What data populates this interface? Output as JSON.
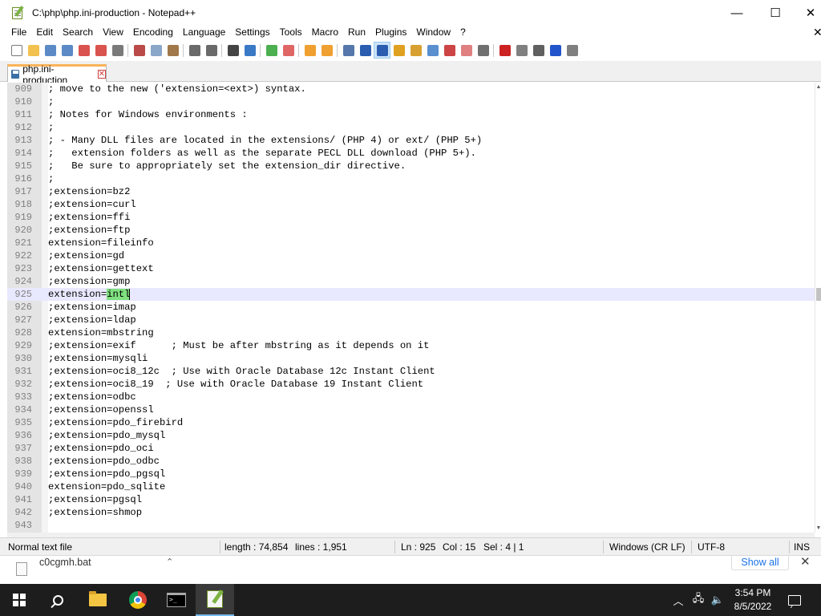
{
  "window": {
    "title": "C:\\php\\php.ini-production - Notepad++",
    "minimize": "—",
    "maximize": "☐",
    "close": "✕"
  },
  "menu": [
    "File",
    "Edit",
    "Search",
    "View",
    "Encoding",
    "Language",
    "Settings",
    "Tools",
    "Macro",
    "Run",
    "Plugins",
    "Window",
    "?"
  ],
  "menu_close": "✕",
  "toolbar_icons": [
    {
      "name": "new-file-icon",
      "color": "#ffffff",
      "border": "#7a7a7a"
    },
    {
      "name": "open-file-icon",
      "color": "#f2c14e"
    },
    {
      "name": "save-icon",
      "color": "#5b8ac7"
    },
    {
      "name": "save-all-icon",
      "color": "#5b8ac7"
    },
    {
      "name": "close-file-icon",
      "color": "#d9534f"
    },
    {
      "name": "close-all-icon",
      "color": "#d9534f"
    },
    {
      "name": "print-icon",
      "color": "#7a7a7a"
    },
    {
      "sep": true
    },
    {
      "name": "cut-icon",
      "color": "#b94a48"
    },
    {
      "name": "copy-icon",
      "color": "#8aa6c8"
    },
    {
      "name": "paste-icon",
      "color": "#a0784a"
    },
    {
      "sep": true
    },
    {
      "name": "undo-icon",
      "color": "#6a6a6a"
    },
    {
      "name": "redo-icon",
      "color": "#6a6a6a"
    },
    {
      "sep": true
    },
    {
      "name": "find-icon",
      "color": "#444444"
    },
    {
      "name": "replace-icon",
      "color": "#3a79c6"
    },
    {
      "sep": true
    },
    {
      "name": "zoom-in-icon",
      "color": "#4caf50"
    },
    {
      "name": "zoom-out-icon",
      "color": "#e06666"
    },
    {
      "sep": true
    },
    {
      "name": "sync-vertical-icon",
      "color": "#f0a030"
    },
    {
      "name": "sync-horizontal-icon",
      "color": "#f0a030"
    },
    {
      "sep": true
    },
    {
      "name": "word-wrap-icon",
      "color": "#5577aa"
    },
    {
      "name": "show-all-chars-icon",
      "color": "#2a5db0"
    },
    {
      "name": "indent-guide-icon",
      "color": "#2a5db0",
      "active": true
    },
    {
      "name": "user-defined-lang-icon",
      "color": "#e0a020"
    },
    {
      "name": "doc-map-icon",
      "color": "#d8a030"
    },
    {
      "name": "doc-list-icon",
      "color": "#5a8fd0"
    },
    {
      "name": "function-list-icon",
      "color": "#cc4444"
    },
    {
      "name": "folder-as-workspace-icon",
      "color": "#e08080"
    },
    {
      "name": "monitoring-icon",
      "color": "#707070"
    },
    {
      "sep": true
    },
    {
      "name": "record-macro-icon",
      "color": "#cc2222"
    },
    {
      "name": "stop-macro-icon",
      "color": "#808080"
    },
    {
      "name": "play-macro-icon",
      "color": "#606060"
    },
    {
      "name": "play-multiple-macro-icon",
      "color": "#2255cc"
    },
    {
      "name": "save-macro-icon",
      "color": "#808080"
    }
  ],
  "tab": {
    "label": "php.ini-production",
    "close": "✕"
  },
  "editor": {
    "current_line_index": 16,
    "lines": [
      {
        "n": "909",
        "text": "; move to the new ('extension=<ext>) syntax."
      },
      {
        "n": "910",
        "text": ";"
      },
      {
        "n": "911",
        "text": "; Notes for Windows environments :"
      },
      {
        "n": "912",
        "text": ";"
      },
      {
        "n": "913",
        "text": "; - Many DLL files are located in the extensions/ (PHP 4) or ext/ (PHP 5+)"
      },
      {
        "n": "914",
        "text": ";   extension folders as well as the separate PECL DLL download (PHP 5+)."
      },
      {
        "n": "915",
        "text": ";   Be sure to appropriately set the extension_dir directive."
      },
      {
        "n": "916",
        "text": ";"
      },
      {
        "n": "917",
        "text": ";extension=bz2"
      },
      {
        "n": "918",
        "text": ";extension=curl"
      },
      {
        "n": "919",
        "text": ";extension=ffi"
      },
      {
        "n": "920",
        "text": ";extension=ftp"
      },
      {
        "n": "921",
        "text": "extension=fileinfo"
      },
      {
        "n": "922",
        "text": ";extension=gd"
      },
      {
        "n": "923",
        "text": ";extension=gettext"
      },
      {
        "n": "924",
        "text": ";extension=gmp"
      },
      {
        "n": "925",
        "text": "extension=",
        "selected": "intl"
      },
      {
        "n": "926",
        "text": ";extension=imap"
      },
      {
        "n": "927",
        "text": ";extension=ldap"
      },
      {
        "n": "928",
        "text": "extension=mbstring"
      },
      {
        "n": "929",
        "text": ";extension=exif      ; Must be after mbstring as it depends on it"
      },
      {
        "n": "930",
        "text": ";extension=mysqli"
      },
      {
        "n": "931",
        "text": ";extension=oci8_12c  ; Use with Oracle Database 12c Instant Client"
      },
      {
        "n": "932",
        "text": ";extension=oci8_19  ; Use with Oracle Database 19 Instant Client"
      },
      {
        "n": "933",
        "text": ";extension=odbc"
      },
      {
        "n": "934",
        "text": ";extension=openssl"
      },
      {
        "n": "935",
        "text": ";extension=pdo_firebird"
      },
      {
        "n": "936",
        "text": ";extension=pdo_mysql"
      },
      {
        "n": "937",
        "text": ";extension=pdo_oci"
      },
      {
        "n": "938",
        "text": ";extension=pdo_odbc"
      },
      {
        "n": "939",
        "text": ";extension=pdo_pgsql"
      },
      {
        "n": "940",
        "text": "extension=pdo_sqlite"
      },
      {
        "n": "941",
        "text": ";extension=pgsql"
      },
      {
        "n": "942",
        "text": ";extension=shmop"
      },
      {
        "n": "943",
        "text": ""
      }
    ]
  },
  "status": {
    "file_type": "Normal text file",
    "length": "length : 74,854",
    "lines": "lines : 1,951",
    "ln": "Ln : 925",
    "col": "Col : 15",
    "sel": "Sel : 4 | 1",
    "eol": "Windows (CR LF)",
    "encoding": "UTF-8",
    "mode": "INS"
  },
  "download": {
    "file": "c0cgmh.bat",
    "chevron": "⌃",
    "show_all": "Show all",
    "close": "✕"
  },
  "taskbar": {
    "time": "3:54 PM",
    "date": "8/5/2022",
    "tray_chevron": "︿",
    "network": "🖧",
    "volume": "🔈"
  },
  "colors": {
    "selection": "#7fe07f",
    "current_line": "#e8e8ff",
    "tab_accent": "#fab45a",
    "link": "#1a73e8"
  }
}
